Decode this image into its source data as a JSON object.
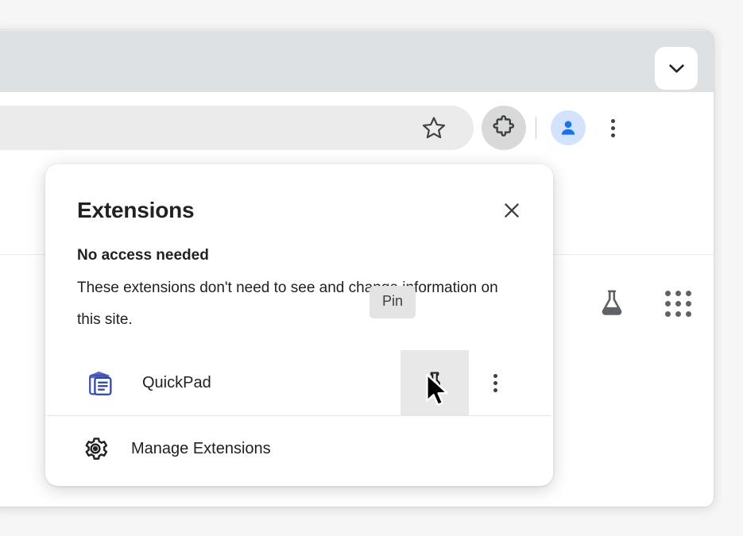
{
  "window": {
    "tabstrip": {
      "collapse_button_icon": "chevron-down-icon"
    },
    "toolbar": {
      "bookmark_icon": "star-icon",
      "extensions_icon": "puzzle-piece-icon",
      "profile_icon": "avatar-person-icon",
      "menu_icon": "three-dot-vertical-icon"
    },
    "page": {
      "labs_icon": "flask-icon",
      "apps_icon": "apps-grid-icon"
    }
  },
  "popup": {
    "title": "Extensions",
    "close_label": "×",
    "close_icon": "close-icon",
    "section": {
      "heading": "No access needed",
      "description": "These extensions don't need to see and change information on this site."
    },
    "extensions": [
      {
        "name": "QuickPad",
        "icon": "quickpad-document-icon",
        "pin_icon": "pin-icon",
        "menu_icon": "three-dot-vertical-icon"
      }
    ],
    "manage": {
      "label": "Manage Extensions",
      "icon": "gear-icon"
    },
    "tooltip": {
      "text": "Pin"
    }
  },
  "colors": {
    "accent_blue": "#1a73e8",
    "avatar_bg": "#d3e2fd",
    "tabstrip_bg": "#dee1e3",
    "omnibox_bg": "#ebebeb",
    "hover_bg": "#e8e8e8",
    "tooltip_bg": "#e4e4e4",
    "text_primary": "#202124",
    "icon_gray": "#5f6368"
  }
}
